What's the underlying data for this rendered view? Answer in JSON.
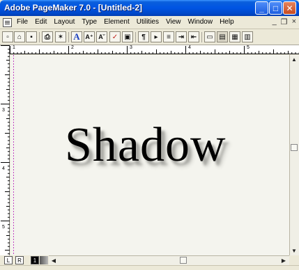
{
  "window": {
    "title": "Adobe PageMaker 7.0 - [Untitled-2]",
    "min_glyph": "_",
    "max_glyph": "□",
    "close_glyph": "✕"
  },
  "menu": {
    "items": [
      "File",
      "Edit",
      "Layout",
      "Type",
      "Element",
      "Utilities",
      "View",
      "Window",
      "Help"
    ],
    "mdi_min": "_",
    "mdi_restore": "❐",
    "mdi_close": "×"
  },
  "toolbar": {
    "icons": [
      "new-icon",
      "open-icon",
      "save-icon",
      "print-icon",
      "find-icon",
      "font-icon",
      "font-size-icon",
      "font-shrink-icon",
      "spell-check-icon",
      "image-icon",
      "paragraph-icon",
      "text-wrap-icon",
      "bullets-icon",
      "indent-icon",
      "outdent-icon",
      "frame-icon",
      "object-icon",
      "layers-icon",
      "library-icon"
    ],
    "glyphs": {
      "font": "A",
      "grow": "A⁺",
      "shrink": "A˘",
      "spell": "✓",
      "para": "¶"
    }
  },
  "rulers": {
    "h_labels": [
      "1",
      "2",
      "3",
      "4",
      "5"
    ],
    "v_labels": [
      "3",
      "4",
      "5"
    ]
  },
  "document": {
    "text": "Shadow"
  },
  "pages": {
    "left": "L",
    "right": "R",
    "current": "1"
  },
  "scroll": {
    "up": "▲",
    "down": "▼",
    "left": "◀",
    "right": "▶"
  },
  "colors": {
    "titlebar": "#0054e3",
    "shadow": "#a9a9a4",
    "canvas": "#f4f4ee"
  }
}
